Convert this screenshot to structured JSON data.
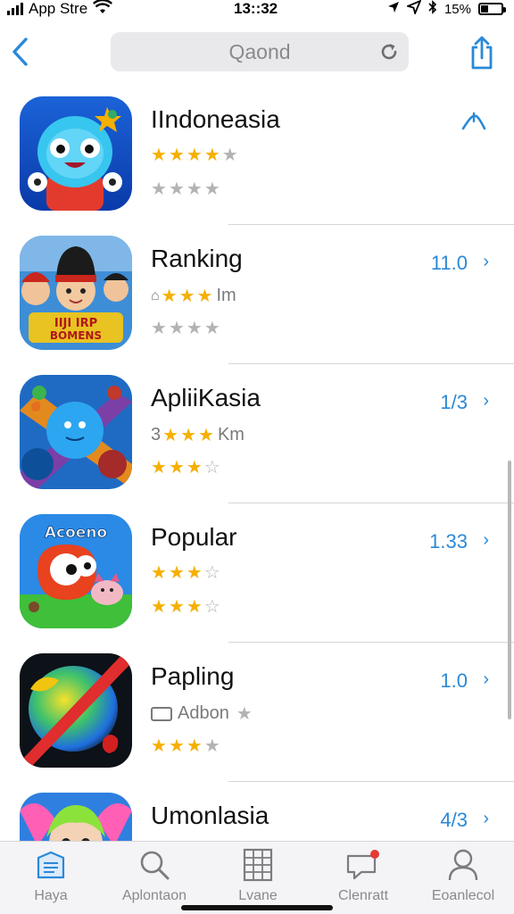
{
  "status_bar": {
    "carrier": "App Stre",
    "time": "13::32",
    "battery_text": "15%"
  },
  "nav": {
    "search_value": "Qaond",
    "icons": {
      "back": "chevron-left-icon",
      "reload": "reload-icon",
      "share": "share-icon"
    }
  },
  "accent_color": "#2a89d8",
  "star_color": "#f5b000",
  "apps": [
    {
      "title": "IIndoneasia",
      "line1_text": "",
      "line1_stars_on": 4,
      "line1_stars_total": 5,
      "line2_stars_on": 0,
      "line2_stars_total": 4,
      "value": "",
      "action_icon": "expand-arrow-icon"
    },
    {
      "title": "Ranking",
      "line1_text": "Im",
      "line1_prefix": "",
      "line1_stars_on": 3,
      "line1_stars_total": 3,
      "line2_stars_on": 0,
      "line2_stars_total": 4,
      "value": "11.0",
      "action_icon": "chevron-right-icon"
    },
    {
      "title": "ApliiKasia",
      "line1_prefix": "3",
      "line1_text": "Km",
      "line1_stars_on": 3,
      "line1_stars_total": 3,
      "line2_stars_on": 3,
      "line2_stars_total": 4,
      "value": "1/3",
      "action_icon": "chevron-right-icon"
    },
    {
      "title": "Popular",
      "line1_prefix": "",
      "line1_text": "",
      "line1_stars_on": 3,
      "line1_stars_total": 4,
      "line2_stars_on": 3,
      "line2_stars_total": 4,
      "value": "1.33",
      "action_icon": "chevron-right-icon"
    },
    {
      "title": "Papling",
      "line1_prefix": "",
      "line1_text": "Adbon",
      "line1_stars_on": 0,
      "line1_stars_total": 1,
      "line2_stars_on": 3,
      "line2_stars_total": 4,
      "value": "1.0",
      "action_icon": "chevron-right-icon"
    },
    {
      "title": "Umonlasia",
      "line1_prefix": "",
      "line1_text": "",
      "line1_stars_on": 0,
      "line1_stars_total": 0,
      "line2_stars_on": 0,
      "line2_stars_total": 0,
      "value": "4/3",
      "action_icon": "chevron-right-icon"
    }
  ],
  "tabs": [
    {
      "label": "Haya",
      "icon": "newspaper-icon"
    },
    {
      "label": "Aplontaon",
      "icon": "search-icon"
    },
    {
      "label": "Lvane",
      "icon": "grid-icon"
    },
    {
      "label": "Clenratt",
      "icon": "chat-icon"
    },
    {
      "label": "Eoanlecol",
      "icon": "person-icon"
    }
  ]
}
